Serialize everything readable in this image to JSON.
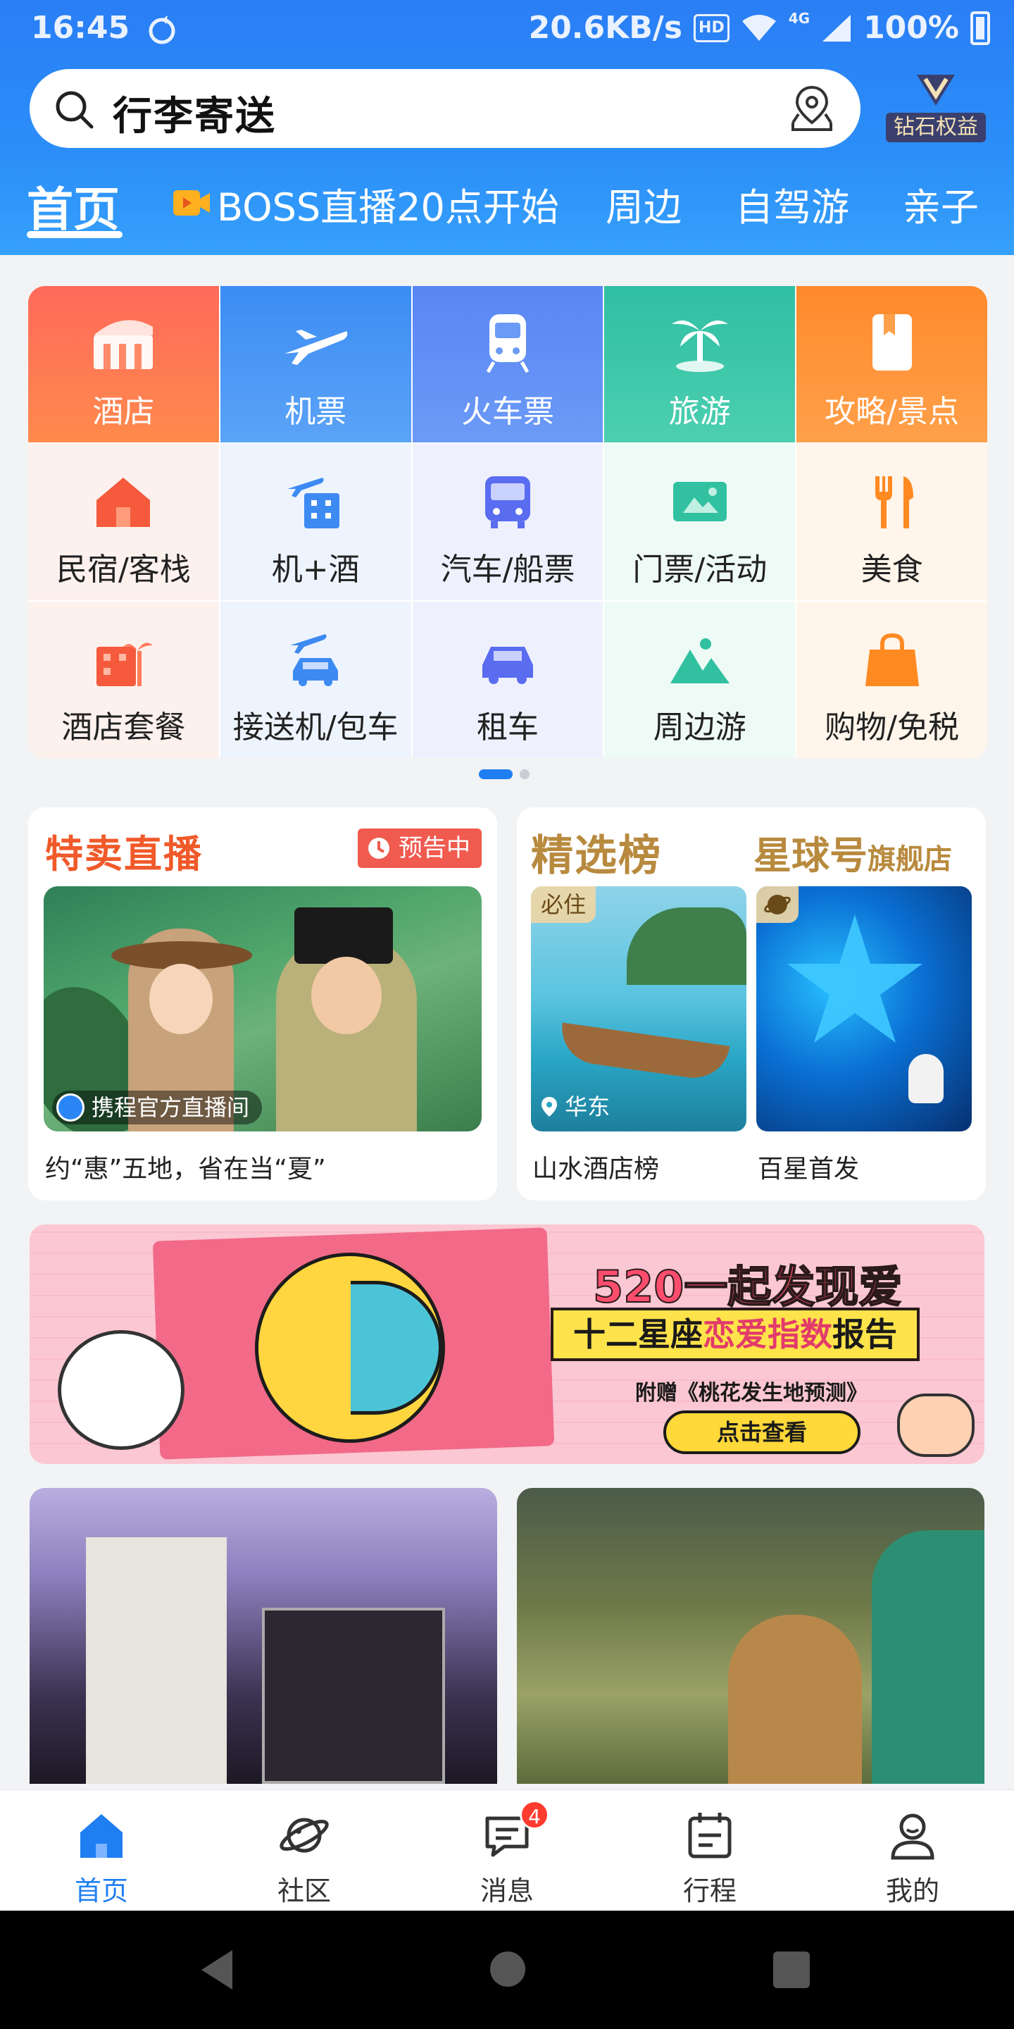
{
  "status_bar": {
    "time": "16:45",
    "network_speed": "20.6KB/s",
    "hd": "HD",
    "net_type": "4G",
    "battery": "100%"
  },
  "search": {
    "query": "行李寄送"
  },
  "membership": {
    "label": "钻石权益"
  },
  "tabs": [
    {
      "label": "首页"
    },
    {
      "label": "BOSS直播20点开始"
    },
    {
      "label": "周边"
    },
    {
      "label": "自驾游"
    },
    {
      "label": "亲子"
    }
  ],
  "grid": {
    "row1": [
      {
        "label": "酒店",
        "icon": "hotel-icon",
        "color": "#ff7a52"
      },
      {
        "label": "机票",
        "icon": "plane-icon",
        "color": "#4b94f5"
      },
      {
        "label": "火车票",
        "icon": "train-icon",
        "color": "#5b8ef4"
      },
      {
        "label": "旅游",
        "icon": "palm-icon",
        "color": "#3ec1a4"
      },
      {
        "label": "攻略/景点",
        "icon": "guide-book-icon",
        "color": "#ff8c36"
      }
    ],
    "row2": [
      {
        "label": "民宿/客栈",
        "icon": "house-icon"
      },
      {
        "label": "机+酒",
        "icon": "flight-hotel-icon"
      },
      {
        "label": "汽车/船票",
        "icon": "bus-icon"
      },
      {
        "label": "门票/活动",
        "icon": "ticket-icon"
      },
      {
        "label": "美食",
        "icon": "food-icon"
      }
    ],
    "row3": [
      {
        "label": "酒店套餐",
        "icon": "hotel-package-icon"
      },
      {
        "label": "接送机/包车",
        "icon": "airport-car-icon"
      },
      {
        "label": "租车",
        "icon": "car-rental-icon"
      },
      {
        "label": "周边游",
        "icon": "mountain-icon"
      },
      {
        "label": "购物/免税",
        "icon": "shopping-bag-icon"
      }
    ]
  },
  "live": {
    "title": "特卖直播",
    "badge": "预告中",
    "channel": "携程官方直播间",
    "caption": "约“惠”五地，省在当“夏”"
  },
  "rank": {
    "title": "精选榜",
    "flagship_title": "星球号",
    "flagship_suffix": "旗舰店",
    "tag_must": "必住",
    "location": "华东",
    "caption_a": "山水酒店榜",
    "caption_b": "百星首发"
  },
  "banner": {
    "title": "520一起发现爱",
    "sub_prefix": "十二星座",
    "sub_highlight": "恋爱指数",
    "sub_suffix": "报告",
    "gift": "附赠《桃花发生地预测》",
    "button": "点击查看"
  },
  "bottom_nav": [
    {
      "label": "首页",
      "icon": "home-icon"
    },
    {
      "label": "社区",
      "icon": "planet-icon"
    },
    {
      "label": "消息",
      "icon": "message-icon",
      "badge": "4"
    },
    {
      "label": "行程",
      "icon": "calendar-icon"
    },
    {
      "label": "我的",
      "icon": "profile-icon"
    }
  ],
  "colors": {
    "brand_blue": "#2b86f5",
    "accent_orange": "#f05a2a",
    "gold": "#b88a3e"
  }
}
